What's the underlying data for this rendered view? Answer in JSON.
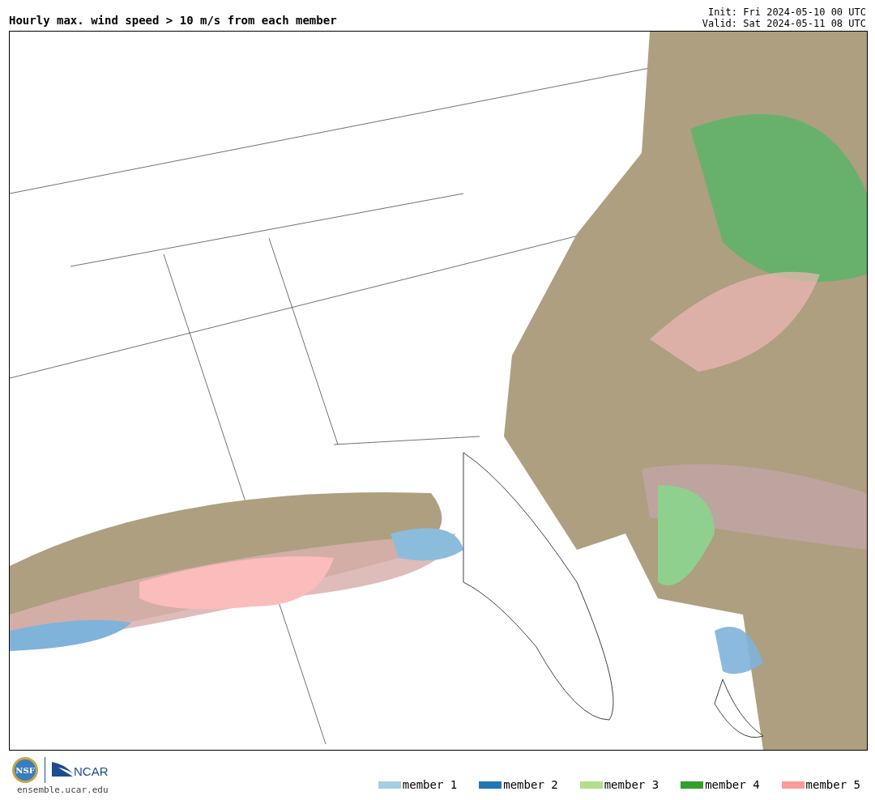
{
  "title": "Hourly max. wind speed > 10 m/s from each member",
  "init": "Init: Fri 2024-05-10 00 UTC",
  "valid": "Valid: Sat 2024-05-11 08 UTC",
  "logos": {
    "nsf": "NSF",
    "ncar": "NCAR"
  },
  "site": "ensemble.ucar.edu",
  "legend": [
    {
      "label": "member 1",
      "color": "#a6cee3"
    },
    {
      "label": "member 2",
      "color": "#1f78b4"
    },
    {
      "label": "member 3",
      "color": "#b2df8a"
    },
    {
      "label": "member 4",
      "color": "#33a02c"
    },
    {
      "label": "member 5",
      "color": "#fb9a99"
    }
  ]
}
